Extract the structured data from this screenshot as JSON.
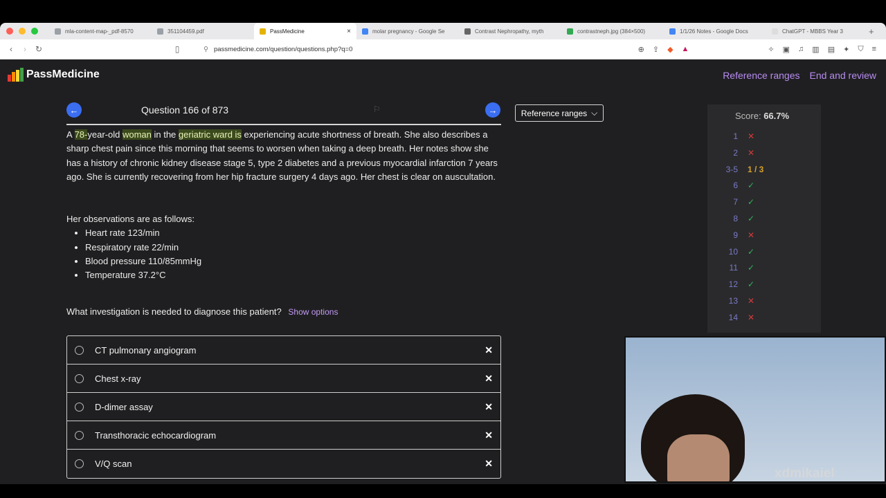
{
  "browser": {
    "tabs": [
      {
        "label": "mla-content-map-_pdf-8570",
        "color": "#9aa0a6"
      },
      {
        "label": "351104459.pdf",
        "color": "#9aa0a6"
      },
      {
        "label": "PassMedicine",
        "color": "#e4b300"
      },
      {
        "label": "molar pregnancy - Google Se",
        "color": "#4285f4"
      },
      {
        "label": "Contrast Nephropathy, myth",
        "color": "#666666"
      },
      {
        "label": "contrastneph.jpg (384×500)",
        "color": "#34a853"
      },
      {
        "label": "1/1/26 Notes - Google Docs",
        "color": "#4285f4"
      },
      {
        "label": "ChatGPT - MBBS Year 3",
        "color": "#dddddd"
      }
    ],
    "url": "passmedicine.com/question/questions.php?q=0"
  },
  "app": {
    "logo": "PassMedicine",
    "nav": {
      "reference": "Reference ranges",
      "end": "End and review"
    },
    "question_counter": "Question 166 of 873",
    "reference_button": "Reference ranges",
    "stem": {
      "p1": "A ",
      "h1": "78-",
      "p2": "year-old ",
      "h2": "woman",
      "p3": " in the ",
      "h3": "geriatric ward is",
      "p4": " experiencing acute shortness of breath. She also describes a sharp chest pain since this morning that seems to worsen when taking a deep breath. Her notes show she has a history of chronic kidney disease stage 5, type 2 diabetes and a previous myocardial infarction 7 years ago. She is currently recovering from her hip fracture surgery 4 days ago. Her chest is clear on auscultation."
    },
    "observations_title": "Her observations are as follows:",
    "observations": [
      "Heart rate 123/min",
      "Respiratory rate 22/min",
      "Blood pressure 110/85mmHg",
      "Temperature 37.2°C"
    ],
    "question": "What investigation is needed to diagnose this patient?",
    "show_options": "Show options",
    "options": [
      "CT pulmonary angiogram",
      "Chest x-ray",
      "D-dimer assay",
      "Transthoracic echocardiogram",
      "V/Q scan"
    ],
    "score_label": "Score:",
    "score_value": "66.7%",
    "score_rows": [
      {
        "n": "1",
        "mark": "✕",
        "kind": "cross"
      },
      {
        "n": "2",
        "mark": "✕",
        "kind": "cross"
      },
      {
        "n": "3-5",
        "mark": "1 / 3",
        "kind": "partial"
      },
      {
        "n": "6",
        "mark": "✓",
        "kind": "tick"
      },
      {
        "n": "7",
        "mark": "✓",
        "kind": "tick"
      },
      {
        "n": "8",
        "mark": "✓",
        "kind": "tick"
      },
      {
        "n": "9",
        "mark": "✕",
        "kind": "cross"
      },
      {
        "n": "10",
        "mark": "✓",
        "kind": "tick"
      },
      {
        "n": "11",
        "mark": "✓",
        "kind": "tick"
      },
      {
        "n": "12",
        "mark": "✓",
        "kind": "tick"
      },
      {
        "n": "13",
        "mark": "✕",
        "kind": "cross"
      },
      {
        "n": "14",
        "mark": "✕",
        "kind": "cross"
      }
    ],
    "watermark": "xdmikaiel"
  },
  "colors": {
    "accent": "#b88df2",
    "nav_arrow": "#3a6df0",
    "highlight": "#3b4a1c"
  }
}
